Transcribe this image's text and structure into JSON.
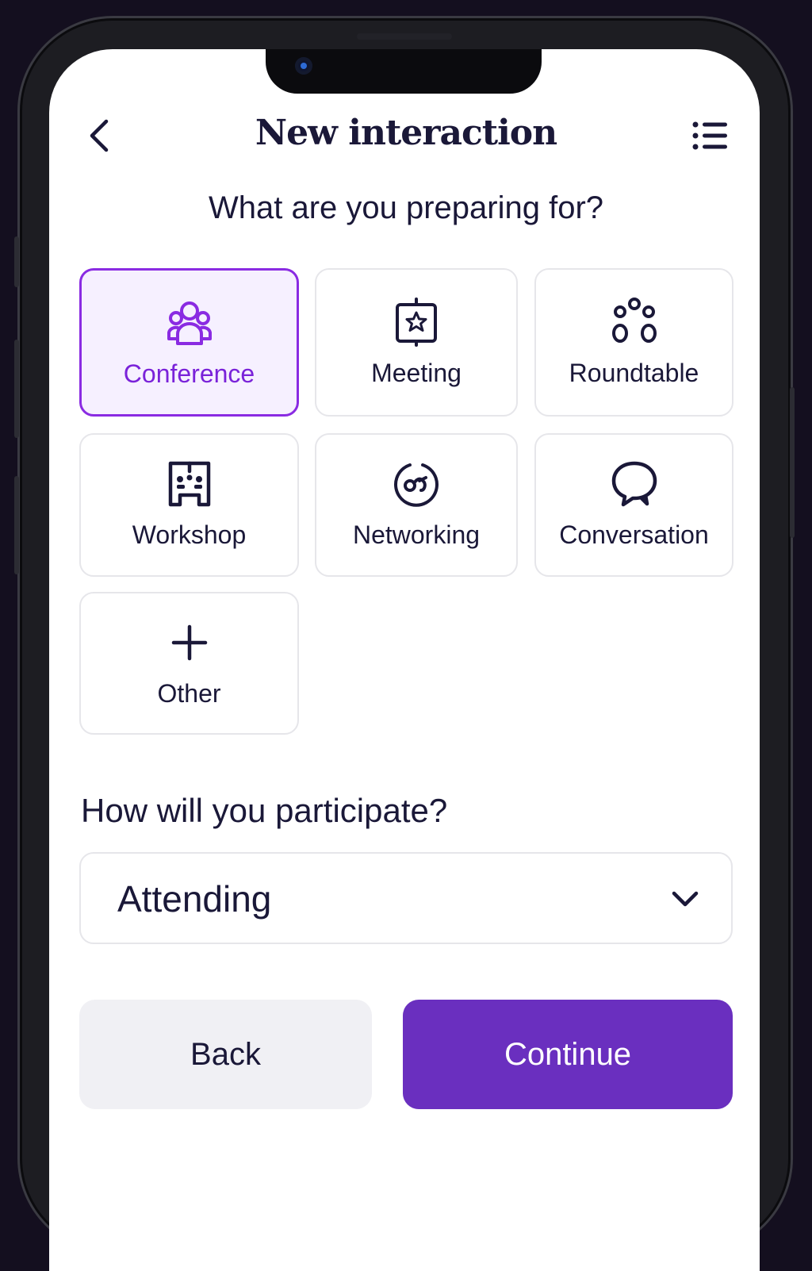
{
  "header": {
    "title": "New interaction",
    "back_icon": "chevron-left-icon",
    "menu_icon": "list-icon"
  },
  "question_type": "What are you preparing for?",
  "options": [
    {
      "label": "Conference",
      "icon": "group-icon",
      "selected": true
    },
    {
      "label": "Meeting",
      "icon": "calendar-star-icon",
      "selected": false
    },
    {
      "label": "Roundtable",
      "icon": "people-circle-icon",
      "selected": false
    },
    {
      "label": "Workshop",
      "icon": "workshop-icon",
      "selected": false
    },
    {
      "label": "Networking",
      "icon": "networking-icon",
      "selected": false
    },
    {
      "label": "Conversation",
      "icon": "chat-bubble-icon",
      "selected": false
    },
    {
      "label": "Other",
      "icon": "plus-icon",
      "selected": false
    }
  ],
  "question_participation": "How will you participate?",
  "participation_select": {
    "value": "Attending",
    "icon": "chevron-down-icon"
  },
  "buttons": {
    "back": "Back",
    "continue": "Continue"
  },
  "colors": {
    "accent": "#8a2be2",
    "accent_text": "#7a22d9",
    "primary_button": "#6a2fbf",
    "secondary_button": "#f0f0f4",
    "text": "#1a1838",
    "frame_background": "#140f1f"
  }
}
